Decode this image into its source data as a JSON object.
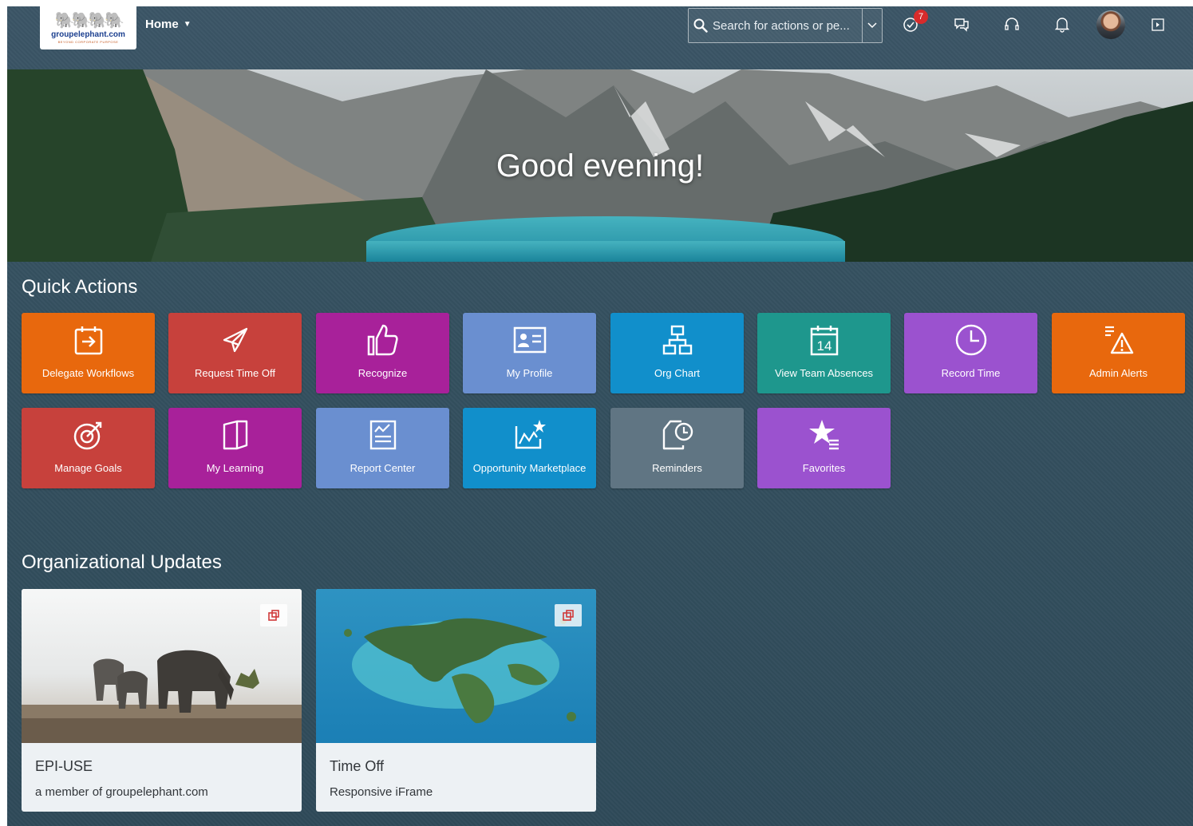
{
  "header": {
    "logo": {
      "text": "groupelephant.com",
      "tagline": "BEYOND CORPORATE PURPOSE"
    },
    "home_label": "Home",
    "search_placeholder": "Search for actions or pe...",
    "todo_badge": "7"
  },
  "banner": {
    "greeting": "Good evening!"
  },
  "quick_actions": {
    "title": "Quick Actions",
    "tiles": [
      {
        "label": "Delegate Workflows",
        "icon": "delegate-calendar-icon",
        "color": "#e8680d"
      },
      {
        "label": "Request Time Off",
        "icon": "airplane-icon",
        "color": "#c7413c"
      },
      {
        "label": "Recognize",
        "icon": "thumbs-up-icon",
        "color": "#a8219a"
      },
      {
        "label": "My Profile",
        "icon": "profile-card-icon",
        "color": "#6a8fd0"
      },
      {
        "label": "Org Chart",
        "icon": "org-chart-icon",
        "color": "#118fcb"
      },
      {
        "label": "View Team Absences",
        "icon": "calendar-14-icon",
        "color": "#1e978d"
      },
      {
        "label": "Record Time",
        "icon": "clock-icon",
        "color": "#9b52cf"
      },
      {
        "label": "Admin Alerts",
        "icon": "alert-icon",
        "color": "#e8680d"
      },
      {
        "label": "Manage Goals",
        "icon": "target-icon",
        "color": "#c7413c"
      },
      {
        "label": "My Learning",
        "icon": "book-icon",
        "color": "#a8219a"
      },
      {
        "label": "Report Center",
        "icon": "report-icon",
        "color": "#6a8fd0"
      },
      {
        "label": "Opportunity Marketplace",
        "icon": "chart-star-icon",
        "color": "#118fcb"
      },
      {
        "label": "Reminders",
        "icon": "reminder-clock-icon",
        "color": "#607583"
      },
      {
        "label": "Favorites",
        "icon": "star-list-icon",
        "color": "#9b52cf"
      }
    ]
  },
  "org_updates": {
    "title": "Organizational Updates",
    "cards": [
      {
        "title": "EPI-USE",
        "subtitle": "a member of groupelephant.com"
      },
      {
        "title": "Time Off",
        "subtitle": "Responsive iFrame"
      }
    ]
  }
}
